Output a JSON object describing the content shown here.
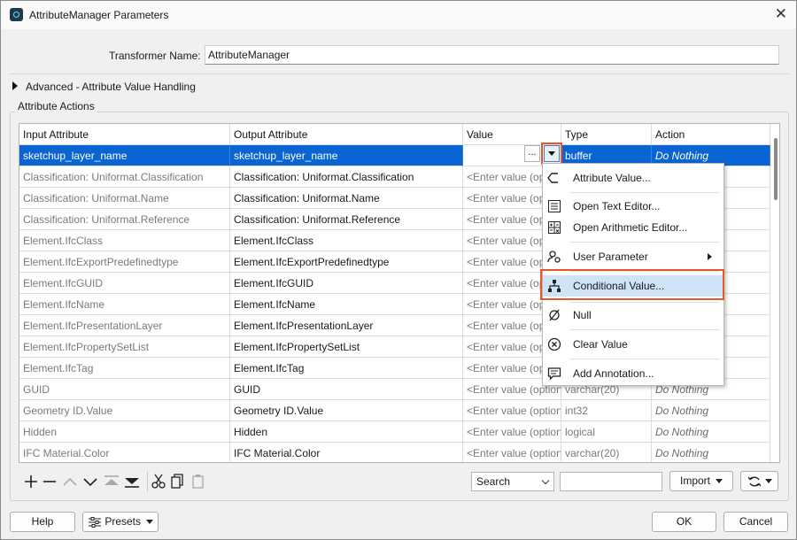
{
  "window": {
    "title": "AttributeManager Parameters",
    "close_glyph": "✕"
  },
  "form": {
    "transformer_name_label": "Transformer Name:",
    "transformer_name_value": "AttributeManager",
    "advanced_label": "Advanced - Attribute Value Handling",
    "actions_group_label": "Attribute Actions"
  },
  "table": {
    "headers": [
      "Input Attribute",
      "Output Attribute",
      "Value",
      "Type",
      "Action"
    ],
    "rows": [
      {
        "input": "sketchup_layer_name",
        "output": "sketchup_layer_name",
        "value": "",
        "type": "buffer",
        "action": "Do Nothing"
      },
      {
        "input": "Classification: Uniformat.Classification",
        "output": "Classification: Uniformat.Classification",
        "value": "<Enter value (optional)>",
        "type": "",
        "action": ""
      },
      {
        "input": "Classification: Uniformat.Name",
        "output": "Classification: Uniformat.Name",
        "value": "<Enter value (optional)>",
        "type": "",
        "action": ""
      },
      {
        "input": "Classification: Uniformat.Reference",
        "output": "Classification: Uniformat.Reference",
        "value": "<Enter value (optional)>",
        "type": "",
        "action": ""
      },
      {
        "input": "Element.IfcClass",
        "output": "Element.IfcClass",
        "value": "<Enter value (optional)>",
        "type": "",
        "action": ""
      },
      {
        "input": "Element.IfcExportPredefinedtype",
        "output": "Element.IfcExportPredefinedtype",
        "value": "<Enter value (optional)>",
        "type": "",
        "action": ""
      },
      {
        "input": "Element.IfcGUID",
        "output": "Element.IfcGUID",
        "value": "<Enter value (optional)>",
        "type": "",
        "action": ""
      },
      {
        "input": "Element.IfcName",
        "output": "Element.IfcName",
        "value": "<Enter value (optional)>",
        "type": "",
        "action": ""
      },
      {
        "input": "Element.IfcPresentationLayer",
        "output": "Element.IfcPresentationLayer",
        "value": "<Enter value (optional)>",
        "type": "",
        "action": ""
      },
      {
        "input": "Element.IfcPropertySetList",
        "output": "Element.IfcPropertySetList",
        "value": "<Enter value (optional)>",
        "type": "",
        "action": ""
      },
      {
        "input": "Element.IfcTag",
        "output": "Element.IfcTag",
        "value": "<Enter value (optional)>",
        "type": "",
        "action": ""
      },
      {
        "input": "GUID",
        "output": "GUID",
        "value": "<Enter value (optional)>",
        "type": "varchar(20)",
        "action": "Do Nothing"
      },
      {
        "input": "Geometry ID.Value",
        "output": "Geometry ID.Value",
        "value": "<Enter value (optional)>",
        "type": "int32",
        "action": "Do Nothing"
      },
      {
        "input": "Hidden",
        "output": "Hidden",
        "value": "<Enter value (optional)>",
        "type": "logical",
        "action": "Do Nothing"
      },
      {
        "input": "IFC Material.Color",
        "output": "IFC Material.Color",
        "value": "<Enter value (optional)>",
        "type": "varchar(20)",
        "action": "Do Nothing"
      }
    ],
    "value_placeholder_display": "<Enter value (opt"
  },
  "value_buttons": {
    "ellipsis": "..."
  },
  "context_menu": {
    "items": [
      {
        "label": "Attribute Value...",
        "icon": "attribute-value-icon"
      },
      {
        "label": "Open Text Editor...",
        "icon": "text-editor-icon"
      },
      {
        "label": "Open Arithmetic Editor...",
        "icon": "arithmetic-editor-icon"
      },
      {
        "label": "User Parameter",
        "icon": "user-parameter-icon"
      },
      {
        "label": "Conditional Value...",
        "icon": "conditional-value-icon"
      },
      {
        "label": "Null",
        "icon": "null-icon"
      },
      {
        "label": "Clear Value",
        "icon": "clear-value-icon"
      },
      {
        "label": "Add Annotation...",
        "icon": "annotation-icon"
      }
    ]
  },
  "toolbar": {
    "search_label": "Search",
    "search_value": "",
    "import_label": "Import"
  },
  "footer": {
    "help": "Help",
    "presets": "Presets",
    "ok": "OK",
    "cancel": "Cancel"
  },
  "colors": {
    "selection": "#0a64d2",
    "highlight": "#e8572b",
    "menu_hover": "#cfe3f7"
  }
}
